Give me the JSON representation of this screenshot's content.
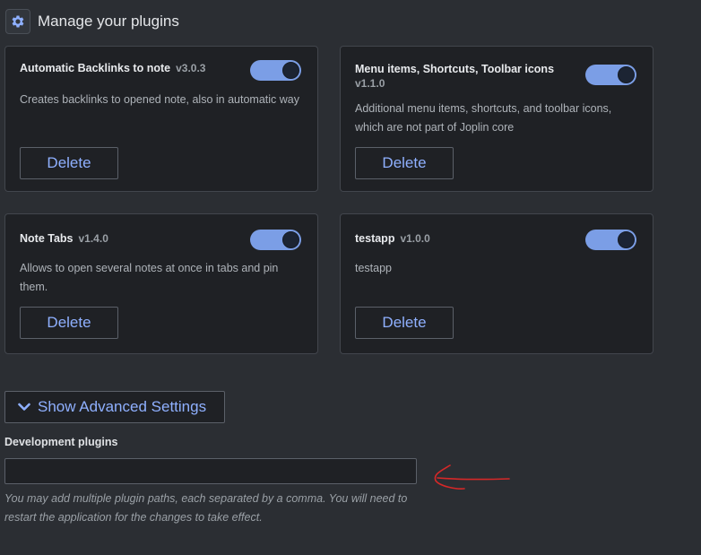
{
  "header": {
    "title": "Manage your plugins",
    "icon": "gear-icon"
  },
  "plugins": [
    {
      "name": "Automatic Backlinks to note",
      "version": "v3.0.3",
      "description": "Creates backlinks to opened note, also in automatic way",
      "enabled": true,
      "delete_label": "Delete"
    },
    {
      "name": "Menu items, Shortcuts, Toolbar icons",
      "version": "v1.1.0",
      "description": "Additional menu items, shortcuts, and toolbar icons, which are not part of Joplin core",
      "enabled": true,
      "delete_label": "Delete"
    },
    {
      "name": "Note Tabs",
      "version": "v1.4.0",
      "description": "Allows to open several notes at once in tabs and pin them.",
      "enabled": true,
      "delete_label": "Delete"
    },
    {
      "name": "testapp",
      "version": "v1.0.0",
      "description": "testapp",
      "enabled": true,
      "delete_label": "Delete"
    }
  ],
  "advanced": {
    "label": "Show Advanced Settings",
    "icon": "chevron-down-icon"
  },
  "dev_plugins": {
    "label": "Development plugins",
    "value": "",
    "help": "You may add multiple plugin paths, each separated by a comma. You will need to restart the application for the changes to take effect."
  },
  "colors": {
    "accent": "#7b9ee6",
    "link": "#8fb0ff",
    "annotation": "#d62828"
  }
}
